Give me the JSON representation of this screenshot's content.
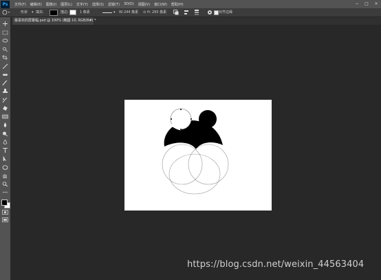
{
  "app": {
    "logo": "Ps"
  },
  "menu": [
    "文件(F)",
    "编辑(E)",
    "图像(I)",
    "图层(L)",
    "文字(Y)",
    "选择(S)",
    "滤镜(T)",
    "3D(D)",
    "视图(V)",
    "窗口(W)",
    "帮助(H)"
  ],
  "window_controls": [
    "−",
    "□",
    "×"
  ],
  "options": {
    "mode": "形状",
    "fill_label": "填充:",
    "stroke_label": "描边:",
    "stroke_width": "1 像素",
    "w_label": "W:",
    "w_value": "244 像素",
    "link_icon": "⊝",
    "h_label": "H:",
    "h_value": "295 像素",
    "align_edges_label": "对齐边缘",
    "align_edges_checked": true
  },
  "document": {
    "tab_title": "最喜欢的屏幕幅.psd @ 100% (椭圆 10, RGB/8#) *",
    "tab_close": "×"
  },
  "tools": [
    "move-tool",
    "marquee-tool",
    "lasso-tool",
    "quick-select-tool",
    "crop-tool",
    "eyedropper-tool",
    "healing-brush-tool",
    "brush-tool",
    "clone-stamp-tool",
    "history-brush-tool",
    "eraser-tool",
    "gradient-tool",
    "blur-tool",
    "dodge-tool",
    "pen-tool",
    "type-tool",
    "path-select-tool",
    "ellipse-tool",
    "hand-tool",
    "zoom-tool",
    "more-tools"
  ],
  "colors": {
    "foreground": "#000000",
    "background": "#ffffff",
    "accent": "#31a8ff"
  },
  "watermark": "https://blog.csdn.net/weixin_44563404"
}
